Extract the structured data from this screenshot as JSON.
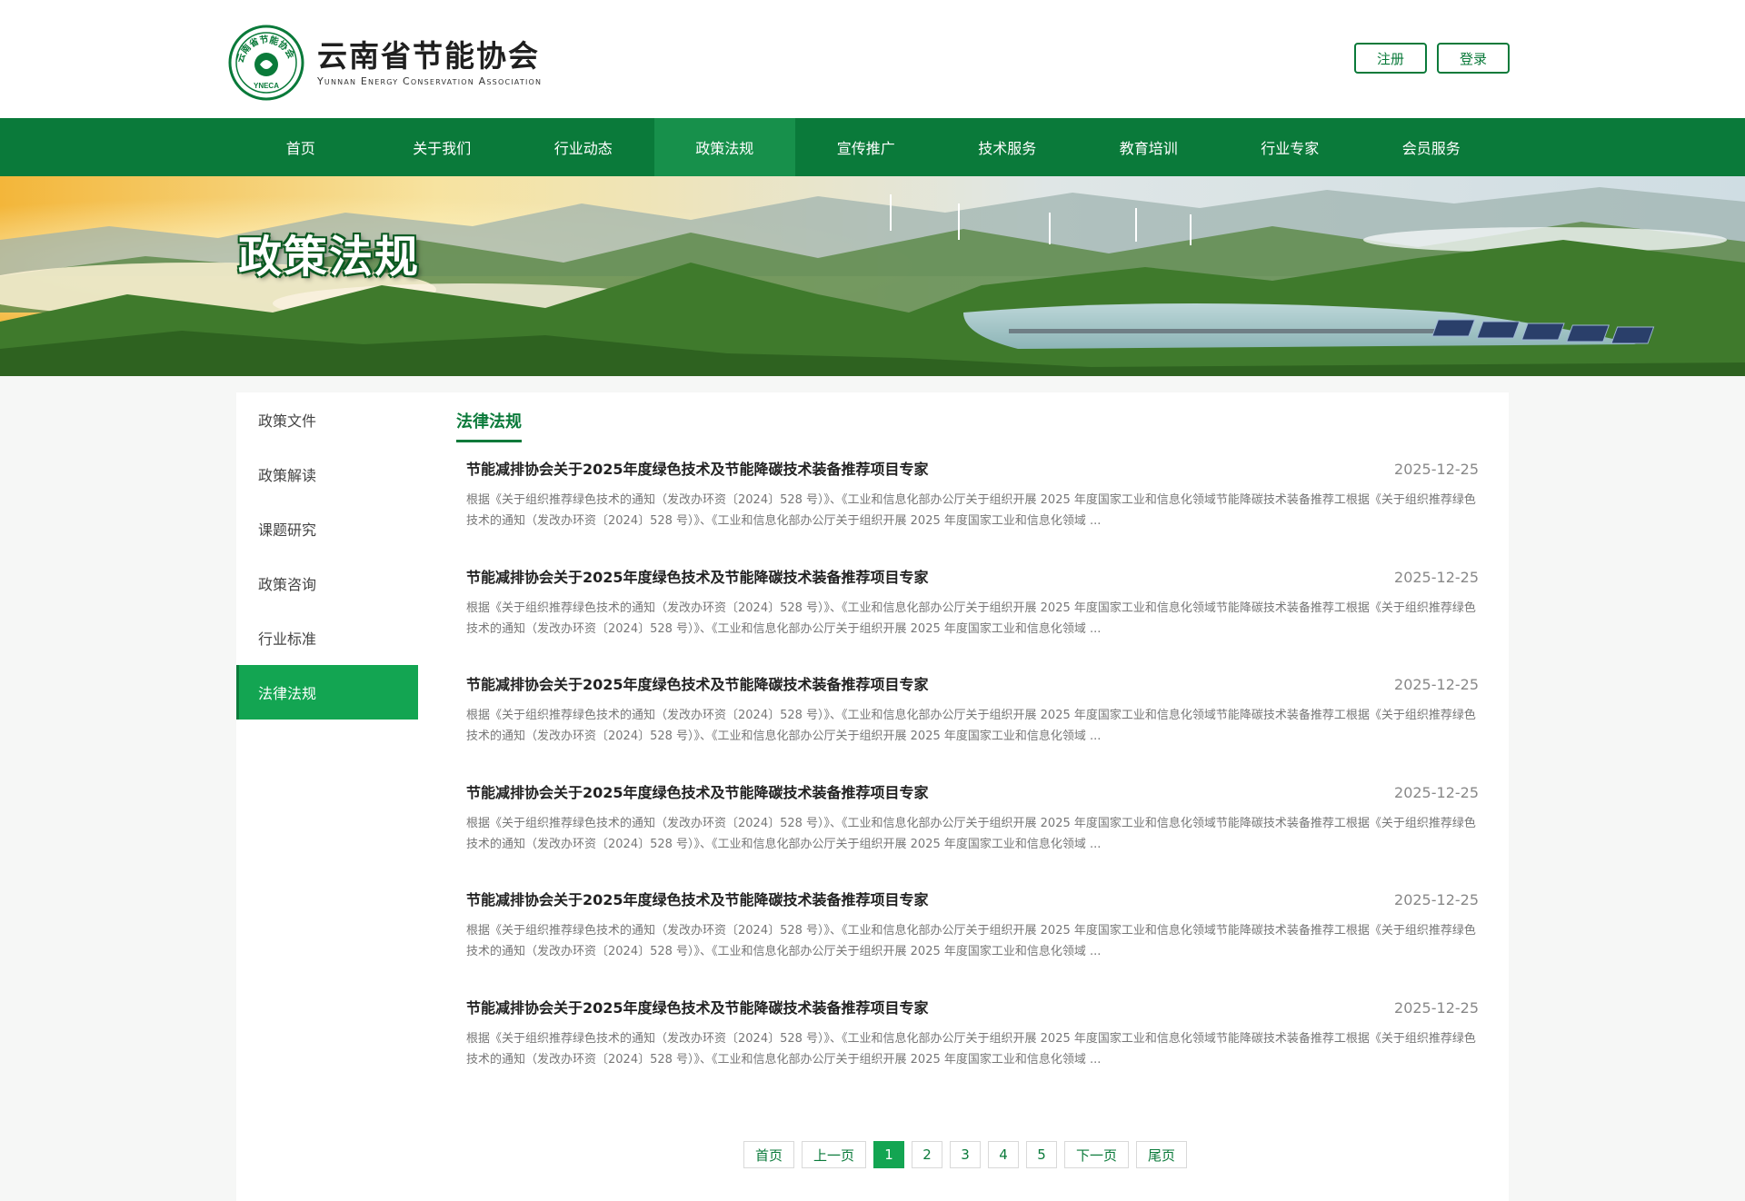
{
  "header": {
    "logo_cn": "云南省节能协会",
    "logo_en": "Yunnan Energy Conservation Association",
    "seal_text": "云南省节能协会",
    "seal_abbr": "YNECA",
    "register_label": "注册",
    "login_label": "登录"
  },
  "nav": {
    "items": [
      "首页",
      "关于我们",
      "行业动态",
      "政策法规",
      "宣传推广",
      "技术服务",
      "教育培训",
      "行业专家",
      "会员服务"
    ],
    "active_index": 3
  },
  "banner": {
    "title": "政策法规"
  },
  "sidebar": {
    "items": [
      "政策文件",
      "政策解读",
      "课题研究",
      "政策咨询",
      "行业标准",
      "法律法规"
    ],
    "active_index": 5
  },
  "main": {
    "section_title": "法律法规",
    "articles": [
      {
        "title": "节能减排协会关于2025年度绿色技术及节能降碳技术装备推荐项目专家",
        "date": "2025-12-25",
        "summary": "根据《关于组织推荐绿色技术的通知（发改办环资〔2024〕528 号）》、《工业和信息化部办公厅关于组织开展 2025 年度国家工业和信息化领域节能降碳技术装备推荐工根据《关于组织推荐绿色技术的通知（发改办环资〔2024〕528 号）》、《工业和信息化部办公厅关于组织开展 2025 年度国家工业和信息化领域 ..."
      },
      {
        "title": "节能减排协会关于2025年度绿色技术及节能降碳技术装备推荐项目专家",
        "date": "2025-12-25",
        "summary": "根据《关于组织推荐绿色技术的通知（发改办环资〔2024〕528 号）》、《工业和信息化部办公厅关于组织开展 2025 年度国家工业和信息化领域节能降碳技术装备推荐工根据《关于组织推荐绿色技术的通知（发改办环资〔2024〕528 号）》、《工业和信息化部办公厅关于组织开展 2025 年度国家工业和信息化领域 ..."
      },
      {
        "title": "节能减排协会关于2025年度绿色技术及节能降碳技术装备推荐项目专家",
        "date": "2025-12-25",
        "summary": "根据《关于组织推荐绿色技术的通知（发改办环资〔2024〕528 号）》、《工业和信息化部办公厅关于组织开展 2025 年度国家工业和信息化领域节能降碳技术装备推荐工根据《关于组织推荐绿色技术的通知（发改办环资〔2024〕528 号）》、《工业和信息化部办公厅关于组织开展 2025 年度国家工业和信息化领域 ..."
      },
      {
        "title": "节能减排协会关于2025年度绿色技术及节能降碳技术装备推荐项目专家",
        "date": "2025-12-25",
        "summary": "根据《关于组织推荐绿色技术的通知（发改办环资〔2024〕528 号）》、《工业和信息化部办公厅关于组织开展 2025 年度国家工业和信息化领域节能降碳技术装备推荐工根据《关于组织推荐绿色技术的通知（发改办环资〔2024〕528 号）》、《工业和信息化部办公厅关于组织开展 2025 年度国家工业和信息化领域 ..."
      },
      {
        "title": "节能减排协会关于2025年度绿色技术及节能降碳技术装备推荐项目专家",
        "date": "2025-12-25",
        "summary": "根据《关于组织推荐绿色技术的通知（发改办环资〔2024〕528 号）》、《工业和信息化部办公厅关于组织开展 2025 年度国家工业和信息化领域节能降碳技术装备推荐工根据《关于组织推荐绿色技术的通知（发改办环资〔2024〕528 号）》、《工业和信息化部办公厅关于组织开展 2025 年度国家工业和信息化领域 ..."
      },
      {
        "title": "节能减排协会关于2025年度绿色技术及节能降碳技术装备推荐项目专家",
        "date": "2025-12-25",
        "summary": "根据《关于组织推荐绿色技术的通知（发改办环资〔2024〕528 号）》、《工业和信息化部办公厅关于组织开展 2025 年度国家工业和信息化领域节能降碳技术装备推荐工根据《关于组织推荐绿色技术的通知（发改办环资〔2024〕528 号）》、《工业和信息化部办公厅关于组织开展 2025 年度国家工业和信息化领域 ..."
      }
    ]
  },
  "pagination": {
    "first": "首页",
    "prev": "上一页",
    "pages": [
      "1",
      "2",
      "3",
      "4",
      "5"
    ],
    "current": "1",
    "next": "下一页",
    "last": "尾页"
  },
  "colors": {
    "brand_green": "#0a7a3a",
    "active_green": "#13a552"
  }
}
